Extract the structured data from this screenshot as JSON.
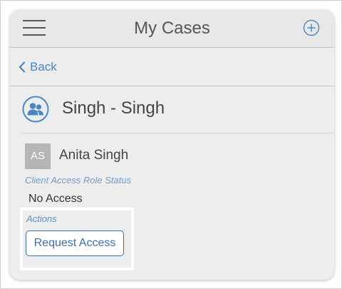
{
  "header": {
    "title": "My Cases",
    "menu_icon": "hamburger-menu-icon",
    "add_icon": "plus-circle-icon"
  },
  "nav": {
    "back_label": "Back",
    "back_icon": "chevron-left-icon"
  },
  "case": {
    "title": "Singh - Singh",
    "avatar_icon": "user-group-icon"
  },
  "client": {
    "initials": "AS",
    "name": "Anita Singh",
    "role_label": "Client Access Role Status",
    "role_value": "No Access"
  },
  "actions": {
    "label": "Actions",
    "request_button": "Request Access"
  },
  "colors": {
    "accent": "#4a86c5",
    "button_border": "#3a6fae",
    "header_bg": "#e8e8e8",
    "panel_bg": "#ededed",
    "avatar_bg": "#b5b5b5"
  }
}
